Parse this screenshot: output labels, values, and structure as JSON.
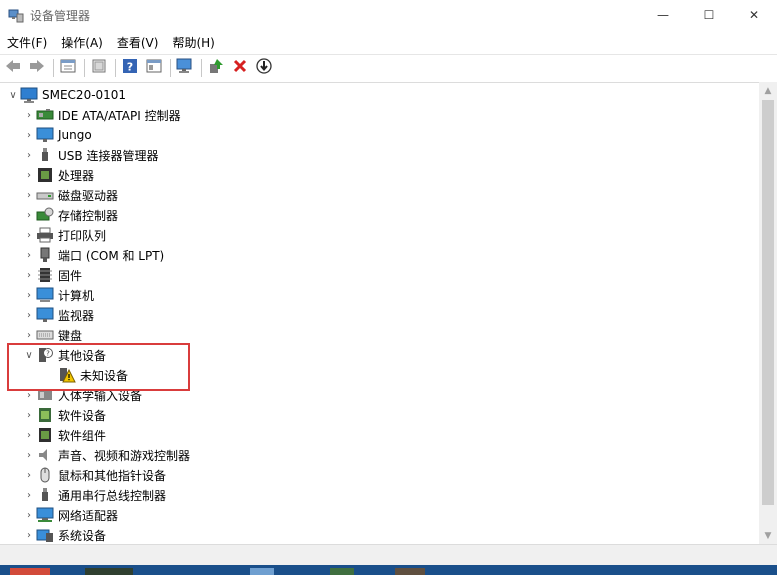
{
  "window": {
    "title": "设备管理器",
    "minimize_glyph": "—",
    "maximize_glyph": "☐",
    "close_glyph": "✕"
  },
  "menu": [
    "文件(F)",
    "操作(A)",
    "查看(V)",
    "帮助(H)"
  ],
  "toolbar": {
    "buttons": [
      "back-icon",
      "forward-icon",
      "properties-icon",
      "print-icon",
      "help-icon",
      "view-icon",
      "scan-hardware-icon",
      "update-driver-icon",
      "uninstall-icon",
      "disable-icon"
    ]
  },
  "tree": {
    "root": {
      "label": "SMEC20-0101",
      "expander": "∨"
    },
    "categories": [
      {
        "label": "IDE ATA/ATAPI 控制器",
        "icon": "ide-controller-icon"
      },
      {
        "label": "Jungo",
        "icon": "monitor-icon"
      },
      {
        "label": "USB 连接器管理器",
        "icon": "usb-icon"
      },
      {
        "label": "处理器",
        "icon": "processor-icon"
      },
      {
        "label": "磁盘驱动器",
        "icon": "disk-drive-icon"
      },
      {
        "label": "存储控制器",
        "icon": "storage-controller-icon"
      },
      {
        "label": "打印队列",
        "icon": "printer-icon"
      },
      {
        "label": "端口 (COM 和 LPT)",
        "icon": "port-icon"
      },
      {
        "label": "固件",
        "icon": "firmware-icon"
      },
      {
        "label": "计算机",
        "icon": "computer-icon"
      },
      {
        "label": "监视器",
        "icon": "monitor-icon"
      },
      {
        "label": "键盘",
        "icon": "keyboard-icon"
      }
    ],
    "other_devices": {
      "label": "其他设备",
      "expander": "∨",
      "icon": "unknown-device-category-icon",
      "child": {
        "label": "未知设备",
        "icon": "warning-device-icon"
      }
    },
    "categories_after": [
      {
        "label": "人体学输入设备",
        "icon": "hid-icon"
      },
      {
        "label": "软件设备",
        "icon": "software-device-icon"
      },
      {
        "label": "软件组件",
        "icon": "software-component-icon"
      },
      {
        "label": "声音、视频和游戏控制器",
        "icon": "audio-icon"
      },
      {
        "label": "鼠标和其他指针设备",
        "icon": "mouse-icon"
      },
      {
        "label": "通用串行总线控制器",
        "icon": "usb-icon"
      },
      {
        "label": "网络适配器",
        "icon": "network-adapter-icon"
      },
      {
        "label": "系统设备",
        "icon": "system-device-icon"
      }
    ],
    "collapsed_glyph": "›"
  },
  "colors": {
    "highlight_border": "#d93c3c",
    "icon_blue": "#2f7fd0",
    "icon_green": "#3a9a3a",
    "icon_red": "#d62020"
  }
}
